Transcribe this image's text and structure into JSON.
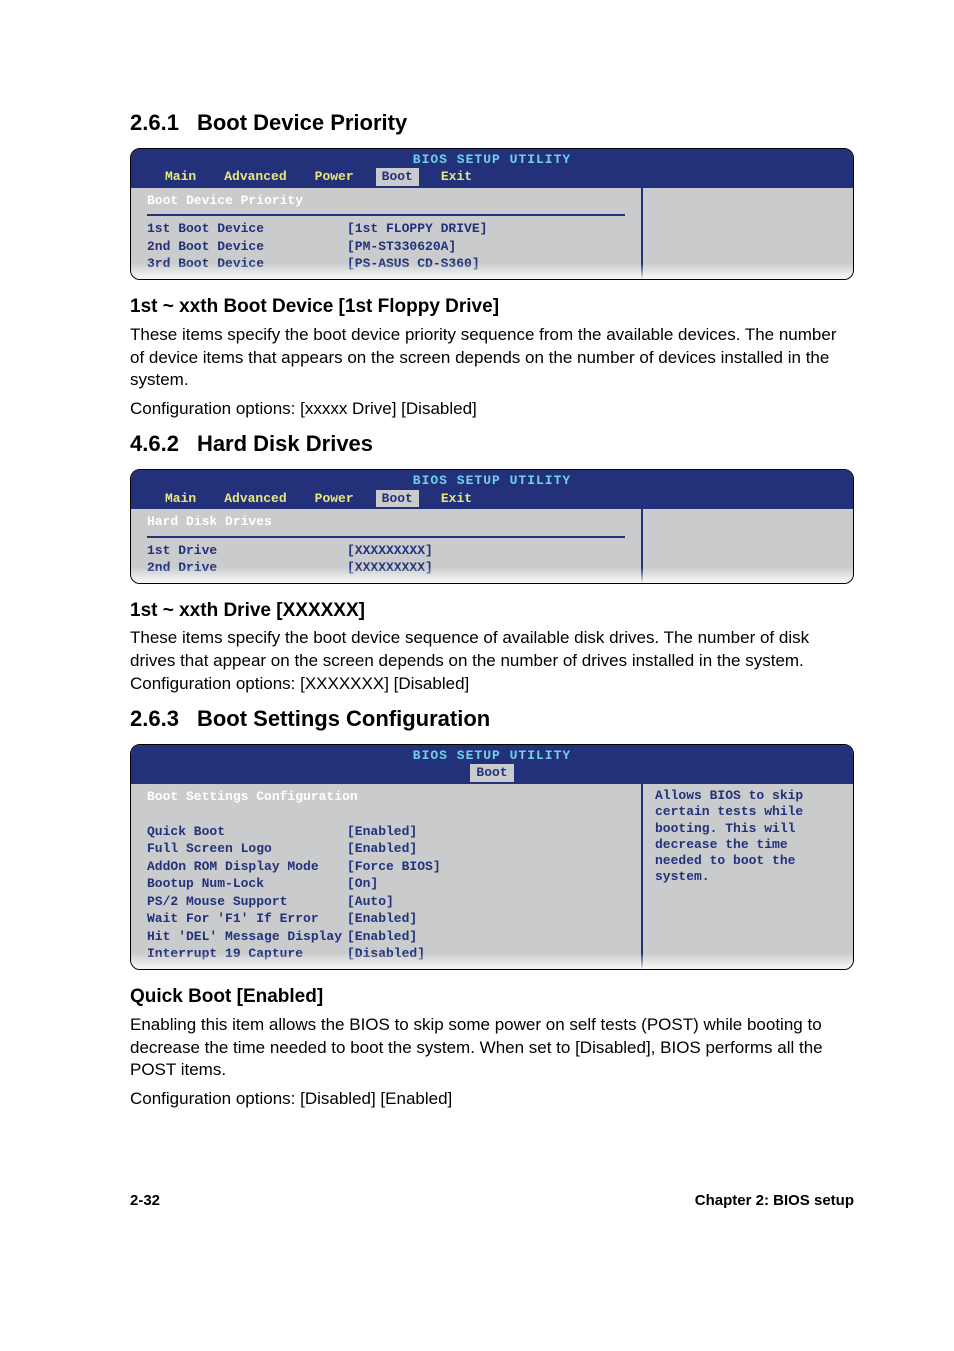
{
  "sec1": {
    "num": "2.6.1",
    "title": "Boot Device Priority",
    "bios": {
      "title": "BIOS SETUP UTILITY",
      "tabs": [
        "Main",
        "Advanced",
        "Power",
        "Boot",
        "Exit"
      ],
      "label": "Boot Device Priority",
      "rows": [
        {
          "k": "1st Boot Device",
          "v": "[1st FLOPPY DRIVE]"
        },
        {
          "k": "2nd Boot Device",
          "v": "[PM-ST330620A]"
        },
        {
          "k": "3rd Boot Device",
          "v": "[PS-ASUS CD-S360]"
        }
      ]
    },
    "sub_title": "1st ~ xxth Boot Device [1st Floppy Drive]",
    "para1": "These items specify the boot device priority sequence from the available devices. The number of device items that appears on the screen depends on the number of devices installed in the system.",
    "para2": "Configuration options: [xxxxx Drive] [Disabled]"
  },
  "sec2": {
    "num": "4.6.2",
    "title": "Hard Disk Drives",
    "bios": {
      "title": "BIOS SETUP UTILITY",
      "tabs": [
        "Main",
        "Advanced",
        "Power",
        "Boot",
        "Exit"
      ],
      "label": "Hard Disk Drives",
      "rows": [
        {
          "k": "1st Drive",
          "v": "[XXXXXXXXX]"
        },
        {
          "k": "2nd Drive",
          "v": "[XXXXXXXXX]"
        }
      ]
    },
    "sub_title": "1st ~ xxth Drive [XXXXXX]",
    "para1": "These items specify the boot device sequence of available disk drives. The number of disk drives that appear on the screen depends on the number of drives installed in the system. Configuration options: [XXXXXXX] [Disabled]"
  },
  "sec3": {
    "num": "2.6.3",
    "title": "Boot Settings Configuration",
    "bios": {
      "title": "BIOS SETUP UTILITY",
      "tabs": [
        "Boot"
      ],
      "label": "Boot Settings Configuration",
      "rows": [
        {
          "k": "Quick Boot",
          "v": "[Enabled]"
        },
        {
          "k": "Full Screen Logo",
          "v": "[Enabled]"
        },
        {
          "k": "AddOn ROM Display Mode",
          "v": "[Force BIOS]"
        },
        {
          "k": "Bootup Num-Lock",
          "v": "[On]"
        },
        {
          "k": "PS/2 Mouse Support",
          "v": "[Auto]"
        },
        {
          "k": "Wait For 'F1' If Error",
          "v": "[Enabled]"
        },
        {
          "k": "Hit 'DEL' Message Display",
          "v": "[Enabled]"
        },
        {
          "k": "Interrupt 19 Capture",
          "v": "[Disabled]"
        }
      ],
      "help": "Allows BIOS to skip certain tests while booting. This will decrease the time needed to boot the system."
    },
    "sub_title": "Quick Boot [Enabled]",
    "para1": "Enabling this item allows the BIOS to skip some power on self tests (POST) while booting to decrease the time needed to boot the system. When set to [Disabled], BIOS performs all the POST items.",
    "para2": "Configuration options: [Disabled] [Enabled]"
  },
  "footer": {
    "left": "2-32",
    "right": "Chapter 2: BIOS setup"
  }
}
